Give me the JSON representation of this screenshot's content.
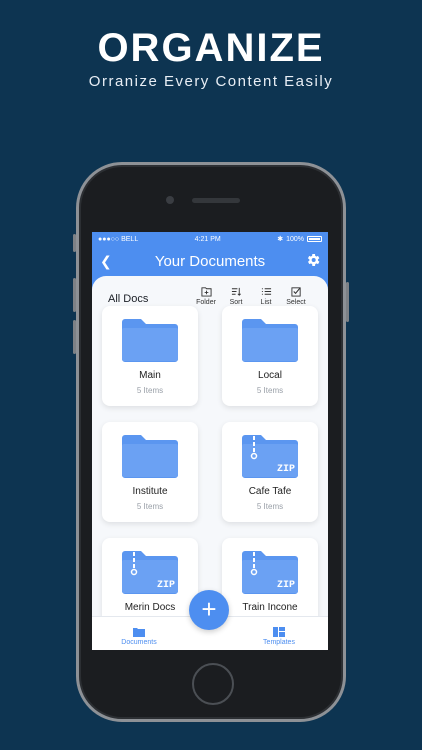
{
  "promo": {
    "headline": "ORGANIZE",
    "subline": "Orranize Every Content Easily"
  },
  "status_bar": {
    "carrier": "●●●○○ BELL",
    "time": "4:21 PM",
    "battery": "100%"
  },
  "app_bar": {
    "title": "Your Documents",
    "back_icon": "chevron-left-icon",
    "settings_icon": "gear-icon"
  },
  "toolbar": {
    "section_title": "All Docs",
    "folder_label": "Folder",
    "sort_label": "Sort",
    "list_label": "List",
    "select_label": "Select"
  },
  "items": [
    {
      "name": "Main",
      "count": "5 Items",
      "type": "folder"
    },
    {
      "name": "Local",
      "count": "5 Items",
      "type": "folder"
    },
    {
      "name": "Institute",
      "count": "5 Items",
      "type": "folder"
    },
    {
      "name": "Cafe Tafe",
      "count": "5 Items",
      "type": "zip"
    },
    {
      "name": "Merin Docs",
      "count": "",
      "type": "zip"
    },
    {
      "name": "Train Incone",
      "count": "",
      "type": "zip"
    }
  ],
  "zip_text": "ZIP",
  "bottom_nav": {
    "documents_label": "Documents",
    "templates_label": "Templates",
    "fab_label": "+"
  },
  "colors": {
    "background": "#0d3451",
    "accent": "#4d8ef0",
    "folder": "#5b96f0"
  }
}
